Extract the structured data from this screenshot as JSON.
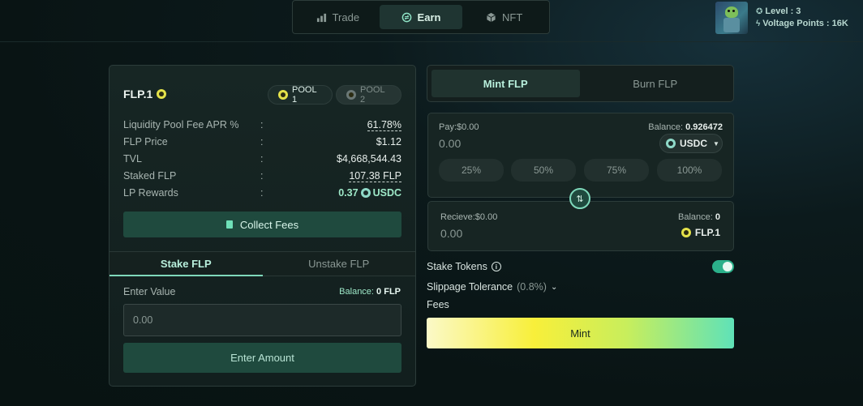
{
  "nav": {
    "tabs": [
      {
        "label": "Trade",
        "icon": "chart-icon"
      },
      {
        "label": "Earn",
        "icon": "swap-icon"
      },
      {
        "label": "NFT",
        "icon": "cube-icon"
      }
    ],
    "active": "Earn"
  },
  "profile": {
    "level": "Level : 3",
    "voltage": "Voltage Points : 16K"
  },
  "stake_panel": {
    "title": "FLP.1",
    "pools": [
      "POOL 1",
      "POOL 2"
    ],
    "stats": [
      {
        "key": "Liquidity Pool Fee APR %",
        "sep": ":",
        "value": "61.78%"
      },
      {
        "key": "FLP Price",
        "sep": ":",
        "value": "$1.12"
      },
      {
        "key": "TVL",
        "sep": ":",
        "value": "$4,668,544.43"
      },
      {
        "key": "Staked FLP",
        "sep": ":",
        "value": "107.38 FLP"
      },
      {
        "key": "LP Rewards",
        "sep": ":",
        "value": "0.37",
        "unit": "USDC"
      }
    ],
    "collect_label": "Collect Fees",
    "tabs": [
      "Stake FLP",
      "Unstake FLP"
    ],
    "enter_label": "Enter Value",
    "balance_prefix": "Balance:",
    "balance_value": "0 FLP",
    "input_placeholder": "0.00",
    "enter_button": "Enter Amount"
  },
  "mint_panel": {
    "tabs": [
      "Mint FLP",
      "Burn FLP"
    ],
    "pay": {
      "label": "Pay:$0.00",
      "balance_prefix": "Balance:",
      "balance_value": "0.926472",
      "amount": "0.00",
      "token": "USDC",
      "percents": [
        "25%",
        "50%",
        "75%",
        "100%"
      ]
    },
    "receive": {
      "label": "Recieve:$0.00",
      "balance_prefix": "Balance:",
      "balance_value": "0",
      "amount": "0.00",
      "token": "FLP.1"
    },
    "stake_tokens_label": "Stake Tokens",
    "stake_tokens_enabled": true,
    "slippage_label": "Slippage Tolerance",
    "slippage_value": "(0.8%)",
    "fees_label": "Fees",
    "mint_button": "Mint"
  },
  "colors": {
    "accent": "#7fd9bb",
    "button_bg": "#1f4a3e",
    "mint_gradient": [
      "#fbf9c8",
      "#f8ef3a",
      "#5fe2b8"
    ]
  }
}
